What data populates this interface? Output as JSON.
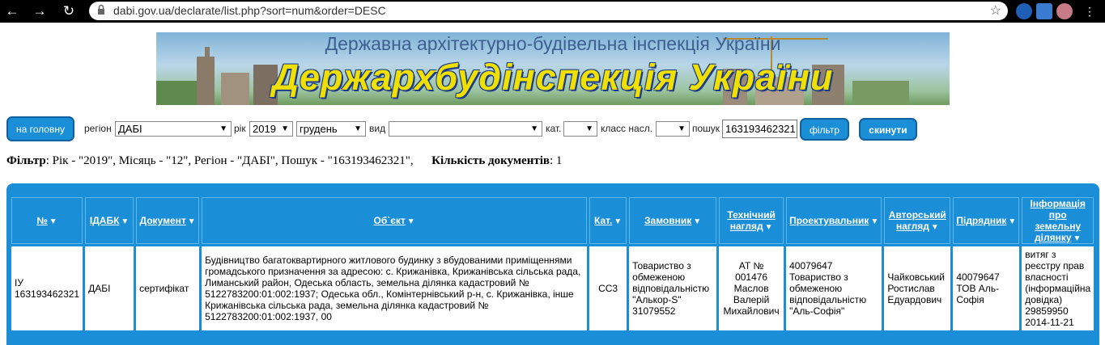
{
  "browser": {
    "url": "dabi.gov.ua/declarate/list.php?sort=num&order=DESC"
  },
  "banner": {
    "subtitle": "Державна архітектурно-будівельна інспекція України",
    "title": "Держархбудінспекція України"
  },
  "filters": {
    "home_label": "на головну",
    "region_label": "регіон",
    "region_value": "ДАБІ",
    "year_label": "рік",
    "year_value": "2019",
    "month_value": "грудень",
    "type_label": "вид",
    "type_value": "",
    "cat_label": "кат.",
    "cat_value": "",
    "class_label": "класс насл.",
    "class_value": "",
    "search_label": "пошук",
    "search_value": "163193462321",
    "filter_button": "фільтр",
    "reset_button": "скинути"
  },
  "summary": {
    "filter_label": "Фільтр",
    "filter_text": ": Рік - \"2019\", Місяць - \"12\", Регіон - \"ДАБІ\", Пошук - \"163193462321\",",
    "count_label": "Кількість документів",
    "count_text": ": 1"
  },
  "table": {
    "columns": [
      "№",
      "ІДАБК",
      "Документ",
      "Об`єкт",
      "Кат.",
      "Замовник",
      "Технічний нагляд",
      "Проектувальник",
      "Авторський нагляд",
      "Підрядник",
      "Інформація про земельну ділянку"
    ],
    "rows": [
      [
        "ІУ 163193462321",
        "ДАБІ",
        "сертифікат",
        "Будівництво багатоквартирного житлового будинку з вбудованими приміщеннями громадського призначення за адресою: с. Крижанівка, Крижанівська сільська рада, Лиманський район, Одеська область, земельна ділянка кадастровий № 5122783200:01:002:1937; Одеська обл., Комінтернівський р-н, с. Крижанівка, інше Крижанівська сільська рада, земельна ділянка кадастровий № 5122783200:01:002:1937, 00",
        "СС3",
        "Товариство з обмеженою відповідальністю \"Алькор-S\" 31079552",
        "АТ № 001476 Маслов Валерій Михайлович",
        "40079647 Товариство з обмеженою відповідальністю \"Аль-Софія\"",
        "Чайковський Ростислав Едуардович",
        "40079647 ТОВ Аль-Софія",
        "витяг з реєстру прав власності (інформаційна довідка) 29859950 2014-11-21"
      ]
    ]
  }
}
